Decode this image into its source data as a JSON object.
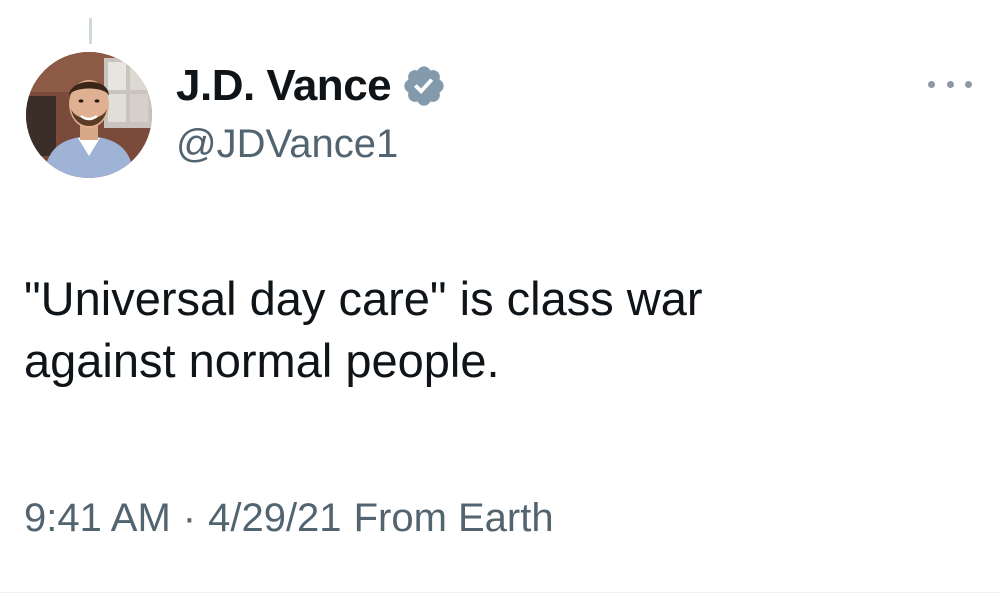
{
  "tweet": {
    "author": {
      "display_name": "J.D. Vance",
      "handle": "@JDVance1",
      "verified": true,
      "verified_icon": "verified-badge-icon",
      "avatar_icon": "profile-photo"
    },
    "text_lines": [
      "\"Universal day care\" is class war",
      "against normal people."
    ],
    "meta": {
      "time": "9:41 AM",
      "separator": "·",
      "date": "4/29/21",
      "source": "From Earth"
    },
    "more_icon": "more-options-icon"
  },
  "colors": {
    "primary_text": "#0f1419",
    "secondary_text": "#536471",
    "verified_badge": "#829aab",
    "background": "#ffffff"
  }
}
